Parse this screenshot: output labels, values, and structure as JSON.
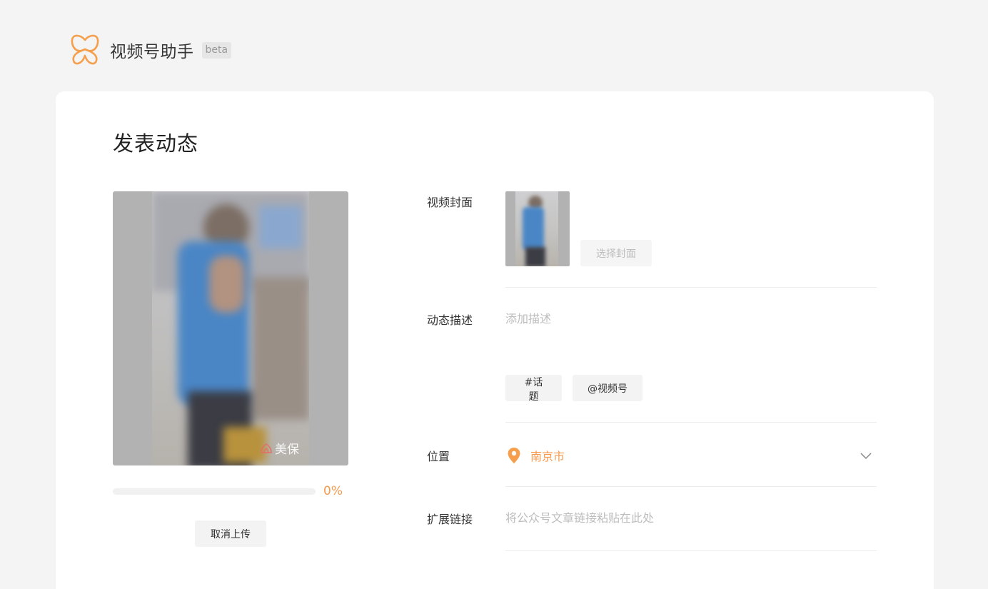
{
  "app": {
    "title": "视频号助手",
    "badge": "beta",
    "brand_color": "#f59f4d",
    "logo_icon": "butterfly-logo-icon"
  },
  "page": {
    "title": "发表动态"
  },
  "upload": {
    "progress_text": "0%",
    "progress_fraction": 0,
    "cancel_label": "取消上传",
    "watermark_text": "美保"
  },
  "form": {
    "cover": {
      "label": "视频封面",
      "choose_label": "选择封面"
    },
    "description": {
      "label": "动态描述",
      "placeholder": "添加描述",
      "value": ""
    },
    "tags": [
      {
        "label": "#话题"
      },
      {
        "label": "@视频号"
      }
    ],
    "location": {
      "label": "位置",
      "value": "南京市",
      "icon": "location-pin-icon",
      "dropdown_icon": "chevron-down-icon"
    },
    "link": {
      "label": "扩展链接",
      "placeholder": "将公众号文章链接粘贴在此处",
      "value": ""
    }
  }
}
